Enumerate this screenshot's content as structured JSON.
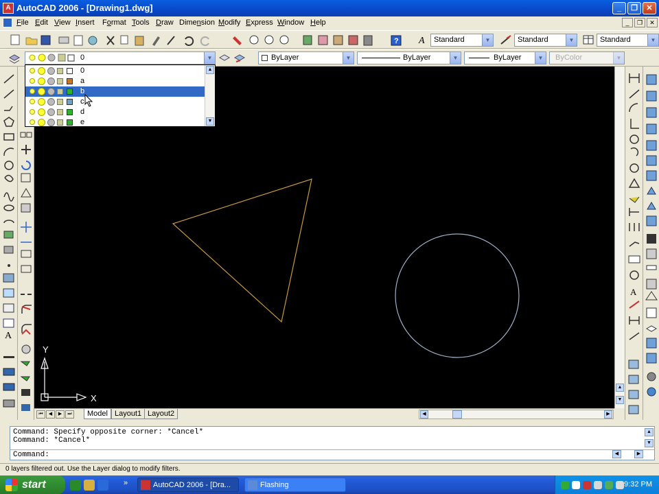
{
  "window": {
    "title": "AutoCAD 2006 - [Drawing1.dwg]",
    "app_icon_glyph": "A",
    "controls": {
      "minimize": "_",
      "maximize": "❐",
      "close": "✕"
    },
    "mdi_controls": {
      "minimize": "_",
      "restore": "❐",
      "close": "✕"
    }
  },
  "menu": [
    {
      "label": "File",
      "u": "F",
      "rest": "ile"
    },
    {
      "label": "Edit",
      "u": "E",
      "rest": "dit"
    },
    {
      "label": "View",
      "u": "V",
      "rest": "iew"
    },
    {
      "label": "Insert",
      "u": "I",
      "rest": "nsert"
    },
    {
      "label": "Format",
      "pre": "F",
      "u": "o",
      "rest": "rmat"
    },
    {
      "label": "Tools",
      "u": "T",
      "rest": "ools"
    },
    {
      "label": "Draw",
      "u": "D",
      "rest": "raw"
    },
    {
      "label": "Dimension",
      "pre": "Dime",
      "u": "n",
      "rest": "sion"
    },
    {
      "label": "Modify",
      "u": "M",
      "rest": "odify"
    },
    {
      "label": "Express",
      "u": "E",
      "rest": "xpress"
    },
    {
      "label": "Window",
      "u": "W",
      "rest": "indow"
    },
    {
      "label": "Help",
      "u": "H",
      "rest": "elp"
    }
  ],
  "styles_toolbar": {
    "text_style": "Standard",
    "dim_style": "Standard",
    "table_style": "Standard"
  },
  "layers_toolbar": {
    "current_layer": "0",
    "color": "ByLayer",
    "linetype": "ByLayer",
    "lineweight": "ByLayer",
    "plot_style": "ByColor"
  },
  "layer_list": [
    {
      "name": "0",
      "color": "#ffffff",
      "selected": false
    },
    {
      "name": "a",
      "color": "#c87820",
      "selected": false
    },
    {
      "name": "b",
      "color": "#30b030",
      "selected": true
    },
    {
      "name": "c",
      "color": "#6fa0c8",
      "selected": false
    },
    {
      "name": "d",
      "color": "#30b030",
      "selected": false
    },
    {
      "name": "e",
      "color": "#30b030",
      "selected": false
    }
  ],
  "drawing": {
    "triangle_color": "#c89a3a",
    "circle_color": "#9ab0c8",
    "ucs_x_label": "X",
    "ucs_y_label": "Y"
  },
  "tabs": {
    "nav": [
      "⏮",
      "◀",
      "▶",
      "⏭"
    ],
    "items": [
      {
        "label": "Model",
        "active": true
      },
      {
        "label": "Layout1",
        "active": false
      },
      {
        "label": "Layout2",
        "active": false
      }
    ]
  },
  "command": {
    "lines": [
      "Command: Specify opposite corner: *Cancel*",
      "Command: *Cancel*",
      "Command:"
    ]
  },
  "status": {
    "text": "0 layers filtered out.  Use the Layer dialog to modify filters."
  },
  "taskbar": {
    "start_label": "start",
    "overflow": "»",
    "buttons": [
      {
        "label": "AutoCAD 2006 - [Dra...",
        "active": true
      },
      {
        "label": "Flashing",
        "active": false
      }
    ],
    "clock": "9:32 PM"
  }
}
